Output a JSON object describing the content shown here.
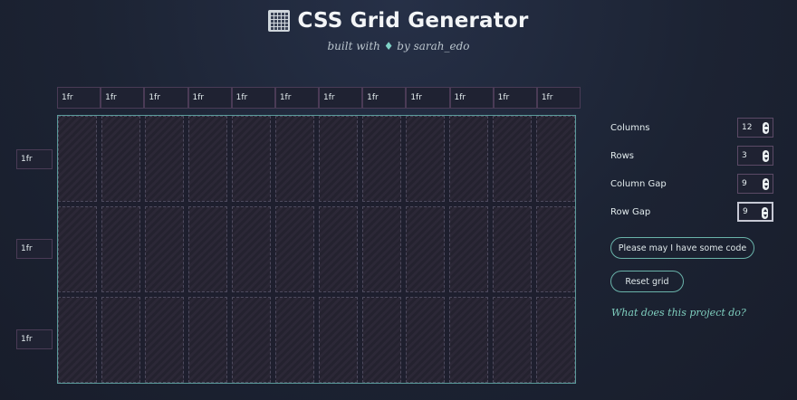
{
  "header": {
    "title": "CSS Grid Generator",
    "subtitle_prefix": "built with",
    "subtitle_suffix": "by sarah_edo"
  },
  "grid": {
    "column_units": [
      "1fr",
      "1fr",
      "1fr",
      "1fr",
      "1fr",
      "1fr",
      "1fr",
      "1fr",
      "1fr",
      "1fr",
      "1fr",
      "1fr"
    ],
    "row_units": [
      "1fr",
      "1fr",
      "1fr"
    ]
  },
  "controls": {
    "columns": {
      "label": "Columns",
      "value": "12"
    },
    "rows": {
      "label": "Rows",
      "value": "3"
    },
    "column_gap": {
      "label": "Column Gap",
      "value": "9"
    },
    "row_gap": {
      "label": "Row Gap",
      "value": "9"
    }
  },
  "buttons": {
    "code": "Please may I have some code",
    "reset": "Reset grid"
  },
  "help_link": "What does this project do?",
  "colors": {
    "accent": "#6ab3aa",
    "link": "#7fcfbf",
    "background": "#1c2333"
  },
  "icons": {
    "logo": "grid-logo-icon",
    "gem": "gem-icon",
    "spinner": "spinner-icon"
  }
}
